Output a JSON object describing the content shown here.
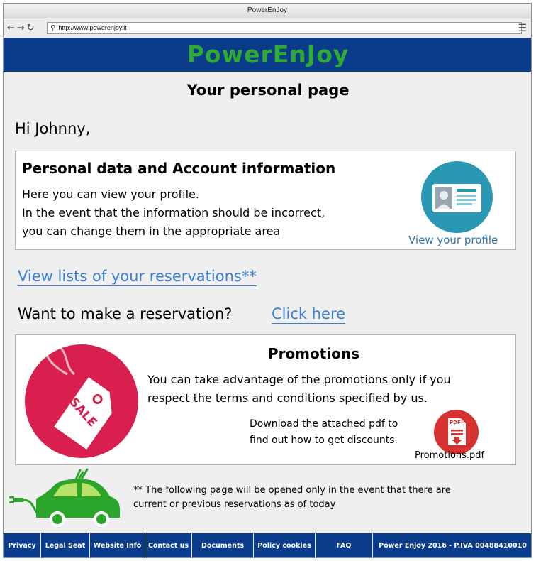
{
  "browser": {
    "title": "PowerEnJoy",
    "url": "http://www.powerenjoy.it"
  },
  "header": {
    "brand": "PowerEnJoy",
    "brand_color": "#2faa35",
    "bg_color": "#0b3c8c"
  },
  "page": {
    "heading": "Your personal page",
    "greeting": "Hi Johnny,"
  },
  "personal_card": {
    "title": "Personal data and Account information",
    "lines": [
      "Here you can view your profile.",
      "In the event that the information should be incorrect,",
      "you can change them in the appropriate area"
    ],
    "profile_link": "View your profile",
    "icon": "id-card-icon"
  },
  "reservations_link": "View lists of your reservations**",
  "reservation_prompt": {
    "question": "Want to make a reservation?",
    "link": "Click here"
  },
  "promotions": {
    "title": "Promotions",
    "lines": [
      "You can take advantage of the promotions only if you",
      "respect the terms and conditions specified by us."
    ],
    "download_lines": [
      "Download the attached pdf to",
      "find out how to get discounts."
    ],
    "pdf_label": "Promotions.pdf",
    "sale_tag": "SALE",
    "pdf_badge": "PDF"
  },
  "note": {
    "lines": [
      "** The following page will be opened only in the event that there are",
      "current or previous reservations as of today"
    ]
  },
  "footer": {
    "items": [
      "Privacy",
      "Legal Seat",
      "Website Info",
      "Contact us",
      "Documents",
      "Policy cookies",
      "FAQ",
      "Power Enjoy 2016 - P.IVA 00488410010"
    ]
  }
}
